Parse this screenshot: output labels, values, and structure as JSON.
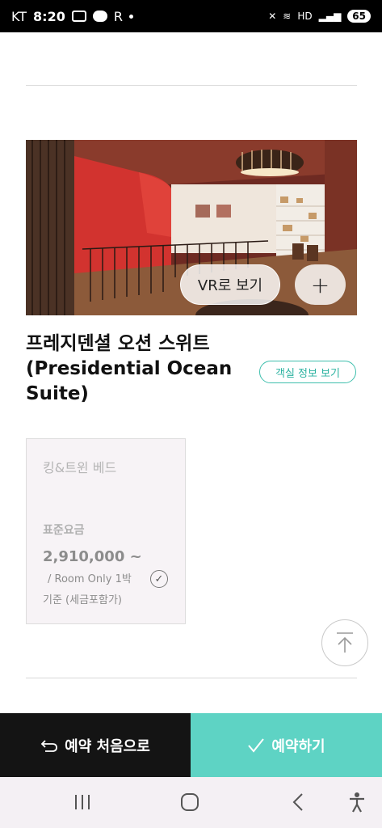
{
  "status_bar": {
    "carrier": "KT",
    "time": "8:20",
    "network": "HD",
    "battery": "65"
  },
  "room": {
    "vr_label": "VR로 보기",
    "plus_label": "+",
    "title": "프레지덴셜 오션 스위트 (Presidential Ocean Suite)",
    "info_button": "객실 정보 보기"
  },
  "rate": {
    "bed_type": "킹&트윈 베드",
    "rate_label": "표준요금",
    "price": "2,910,000 ~",
    "unit": "/ Room Only 1박",
    "tax_note": "기준 (세금포함가)"
  },
  "actions": {
    "restart_label": "예약 처음으로",
    "book_label": "예약하기"
  },
  "colors": {
    "accent": "#5ed3c4",
    "accent_text": "#2ab2a0",
    "dark_button": "#141414"
  },
  "icons": [
    "scroll-top-icon",
    "undo-arrow-icon",
    "check-icon",
    "recent-apps-icon",
    "home-icon",
    "back-icon",
    "accessibility-icon"
  ]
}
